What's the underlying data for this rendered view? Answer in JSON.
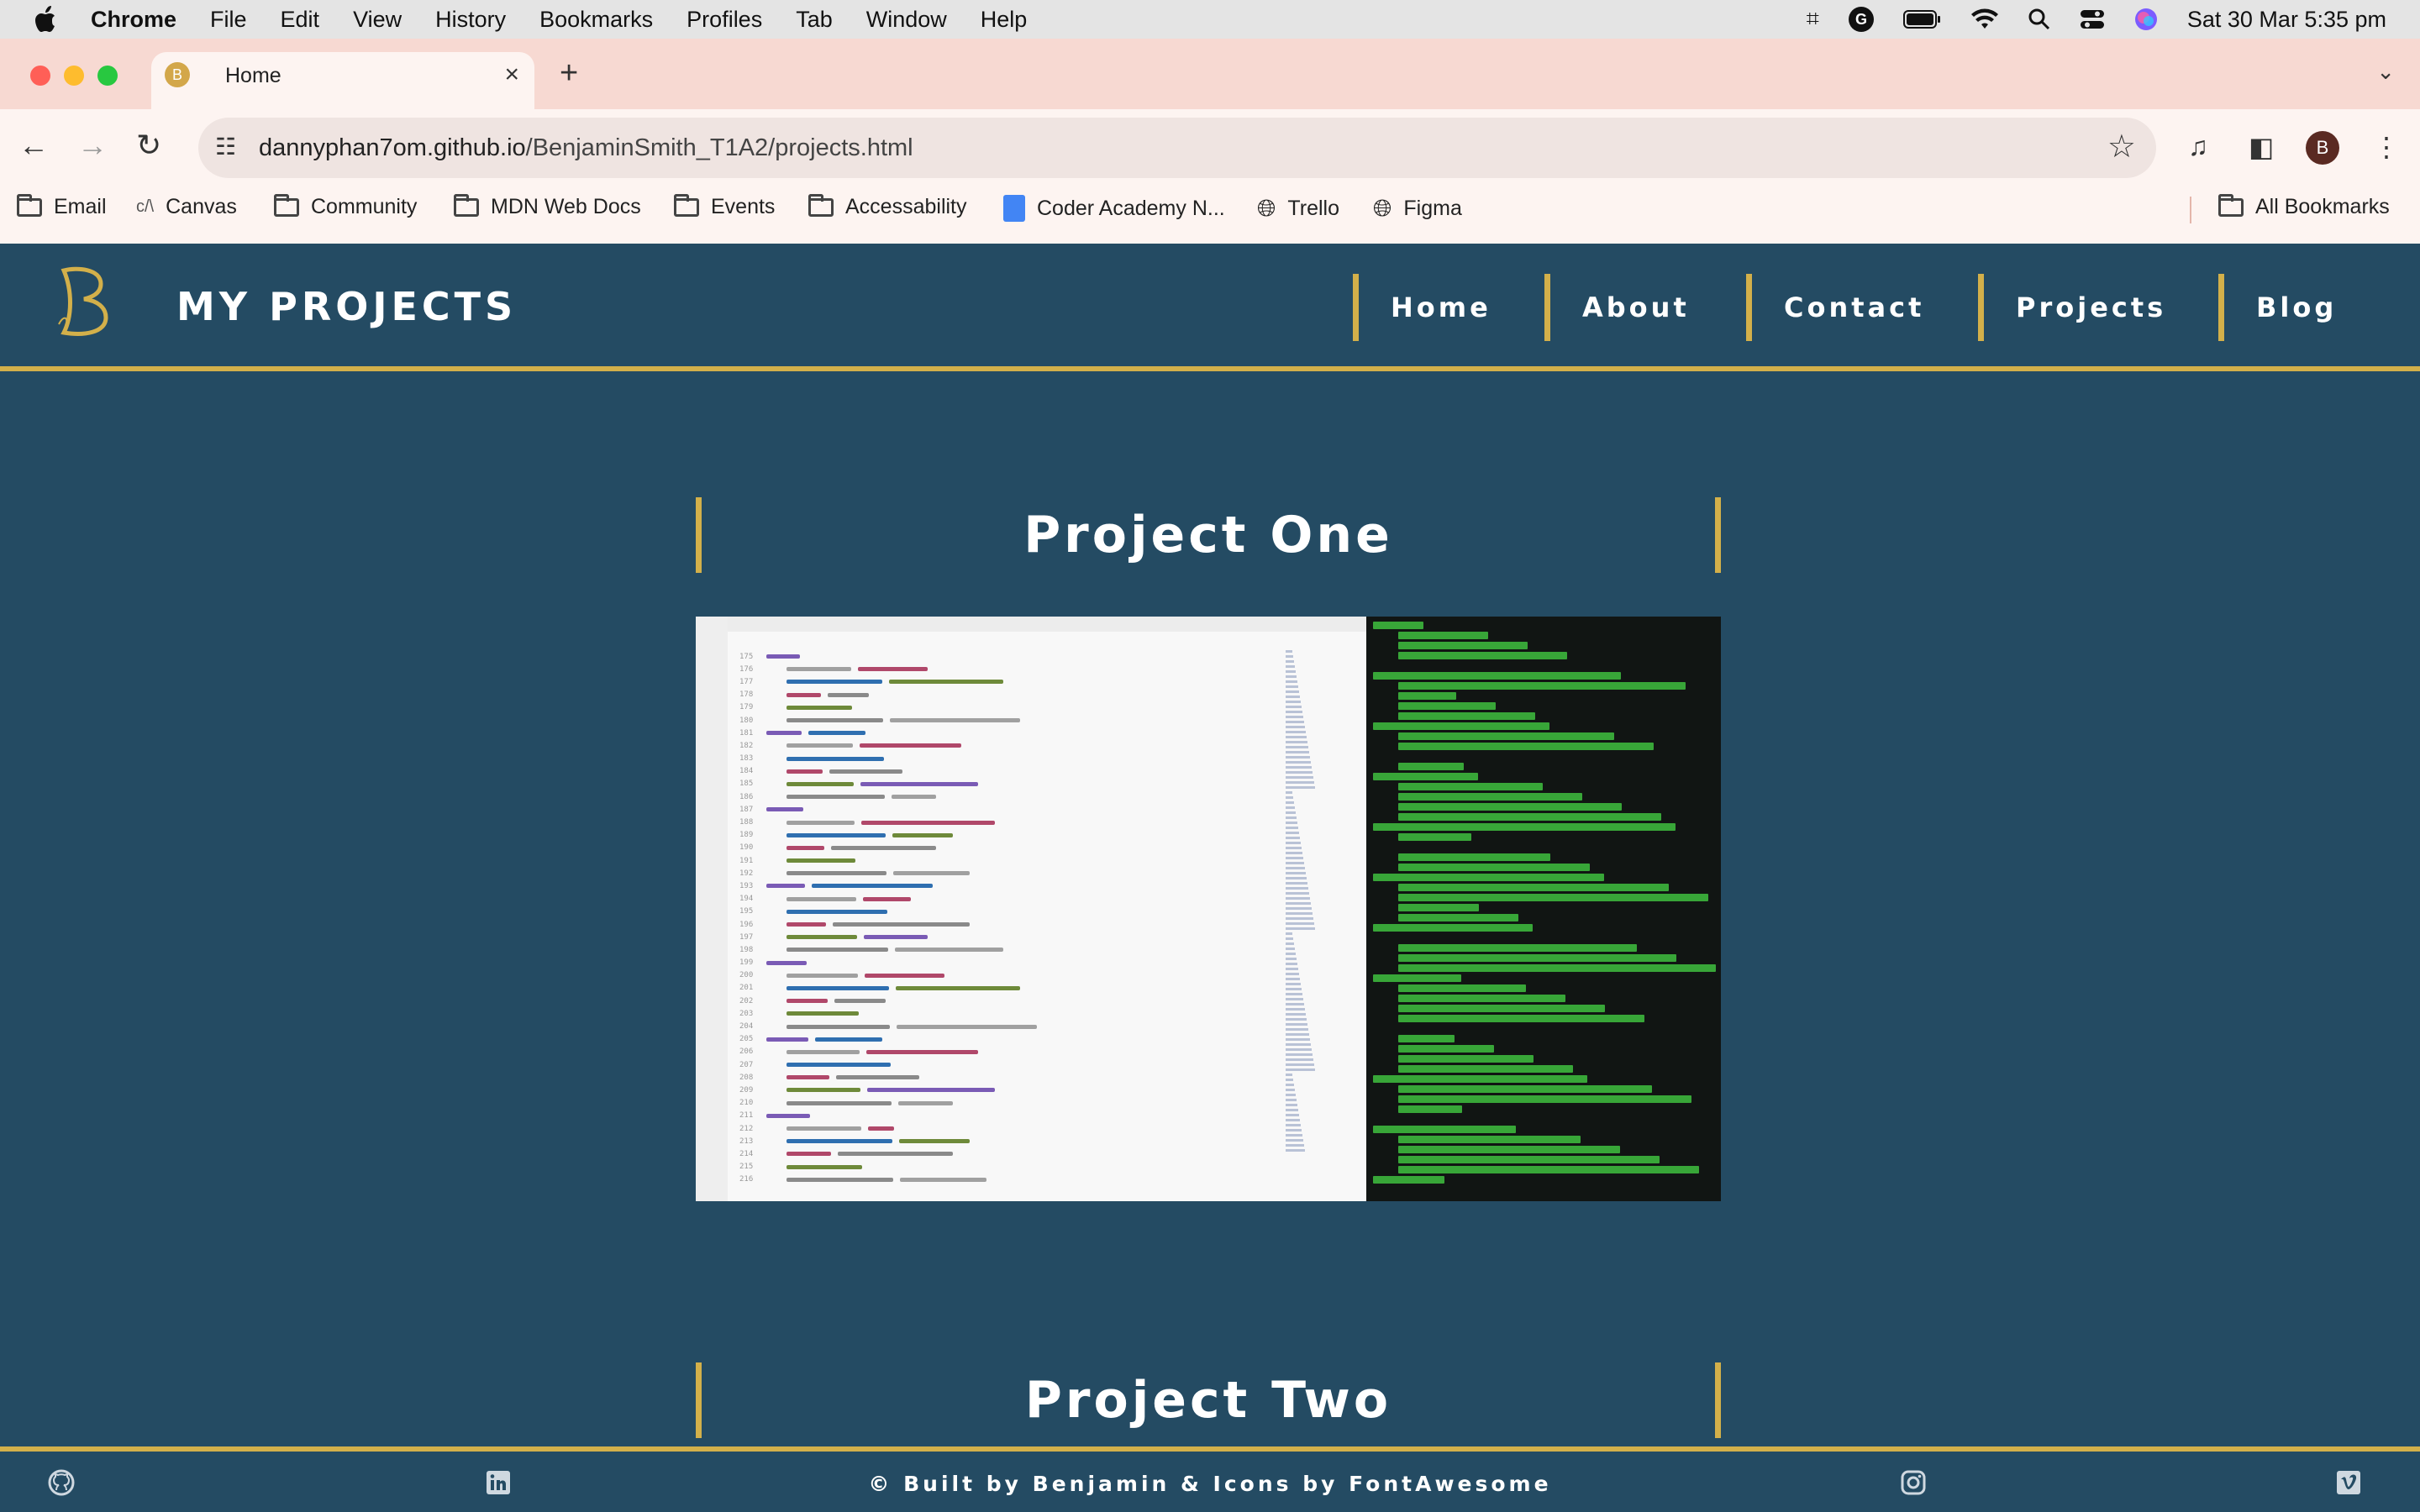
{
  "menubar": {
    "app": "Chrome",
    "items": [
      "File",
      "Edit",
      "View",
      "History",
      "Bookmarks",
      "Profiles",
      "Tab",
      "Window",
      "Help"
    ],
    "clock": "Sat 30 Mar  5:35 pm"
  },
  "tab": {
    "title": "Home",
    "favicon": "B"
  },
  "omnibox": {
    "url_host": "dannyphan7om.github.io",
    "url_path": "/BenjaminSmith_T1A2/projects.html"
  },
  "profile_initial": "B",
  "bookmarks": {
    "items": [
      "Email",
      "Canvas",
      "Community",
      "MDN Web Docs",
      "Events",
      "Accessability",
      "Coder Academy N...",
      "Trello",
      "Figma"
    ],
    "all": "All Bookmarks"
  },
  "site": {
    "title": "MY PROJECTS",
    "nav": [
      "Home",
      "About",
      "Contact",
      "Projects",
      "Blog"
    ],
    "accent": "#d3b04a",
    "background": "#244b63"
  },
  "projects": [
    "Project One",
    "Project Two"
  ],
  "footer": {
    "text": "© Built by Benjamin & Icons by FontAwesome"
  }
}
